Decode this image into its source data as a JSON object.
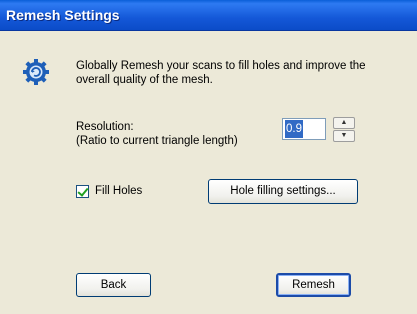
{
  "window": {
    "title": "Remesh Settings"
  },
  "info": {
    "icon": "remesh-gear-icon",
    "description": "Globally Remesh your scans to fill holes and improve the overall quality of the mesh."
  },
  "resolution": {
    "label_line1": "Resolution:",
    "label_line2": "(Ratio to current triangle length)",
    "value": "0.9"
  },
  "fill_holes": {
    "label": "Fill Holes",
    "checked": true
  },
  "buttons": {
    "hole_settings": "Hole filling settings...",
    "back": "Back",
    "remesh": "Remesh"
  },
  "colors": {
    "title_bar": "#1458D8",
    "dialog_bg": "#ECE9D8",
    "selection": "#316AC5"
  }
}
